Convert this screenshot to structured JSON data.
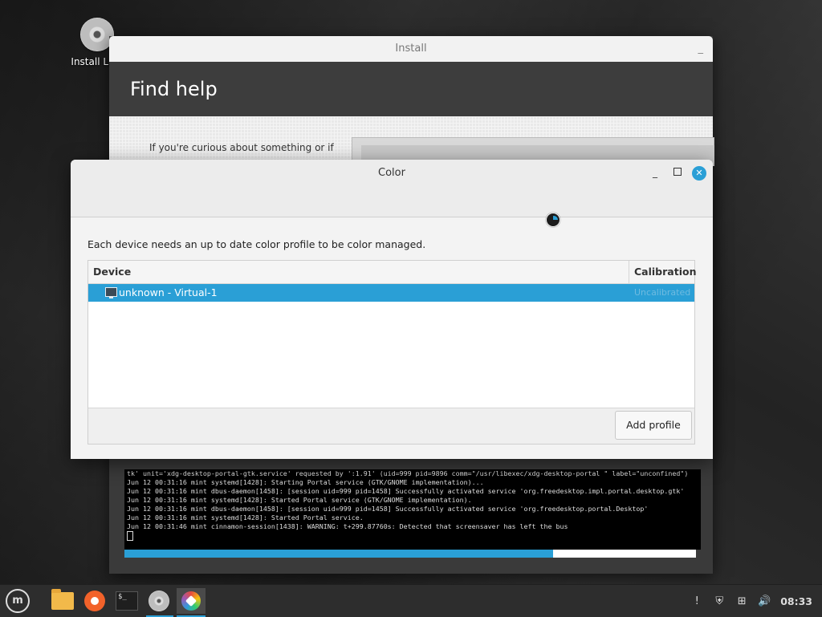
{
  "desktop": {
    "icon_label": "Install Linu"
  },
  "install_window": {
    "title": "Install",
    "min_symbol": "_",
    "header": "Find help",
    "help_text": "If you're curious about something or if",
    "terminal_lines": [
      "tk' unit='xdg-desktop-portal-gtk.service' requested by ':1.91' (uid=999 pid=9896 comm=\"/usr/libexec/xdg-desktop-portal \" label=\"unconfined\")",
      "Jun 12 00:31:16 mint systemd[1428]: Starting Portal service (GTK/GNOME implementation)...",
      "Jun 12 00:31:16 mint dbus-daemon[1458]: [session uid=999 pid=1458] Successfully activated service 'org.freedesktop.impl.portal.desktop.gtk'",
      "Jun 12 00:31:16 mint systemd[1428]: Started Portal service (GTK/GNOME implementation).",
      "Jun 12 00:31:16 mint dbus-daemon[1458]: [session uid=999 pid=1458] Successfully activated service 'org.freedesktop.portal.Desktop'",
      "Jun 12 00:31:16 mint systemd[1428]: Started Portal service.",
      "Jun 12 00:31:46 mint cinnamon-session[1438]: WARNING: t+299.87760s: Detected that screensaver has left the bus"
    ],
    "progress_percent": 75
  },
  "color_dialog": {
    "title": "Color",
    "minimize_symbol": "_",
    "close_symbol": "✕",
    "description": "Each device needs an up to date color profile to be color managed.",
    "columns": {
      "device": "Device",
      "calibration": "Calibration"
    },
    "rows": [
      {
        "device": "unknown - Virtual-1",
        "calibration": "Uncalibrated"
      }
    ],
    "add_profile_label": "Add profile"
  },
  "taskbar": {
    "mint_symbol": "m",
    "terminal_symbol": "$_",
    "clock": "08:33"
  },
  "icons": {
    "tray": [
      "notification-icon",
      "shield-icon",
      "network-icon",
      "volume-icon"
    ],
    "tray_glyphs": [
      "!",
      "⛨",
      "⊞",
      "🔊"
    ]
  },
  "colors": {
    "accent": "#2a9fd6"
  }
}
